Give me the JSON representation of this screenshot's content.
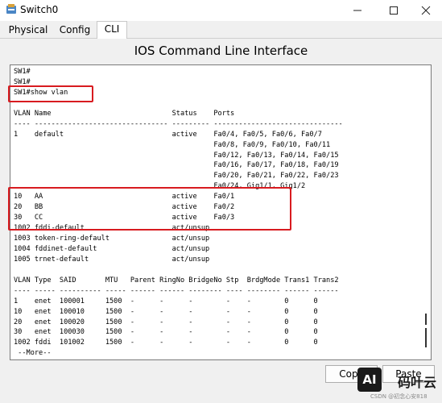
{
  "window": {
    "title": "Switch0",
    "minimize_icon": "minimize-icon",
    "maximize_icon": "maximize-icon",
    "close_icon": "close-icon"
  },
  "tabs": [
    {
      "label": "Physical",
      "active": false
    },
    {
      "label": "Config",
      "active": false
    },
    {
      "label": "CLI",
      "active": true
    }
  ],
  "cli_title": "IOS Command Line Interface",
  "terminal_lines": [
    "SW1#",
    "SW1#",
    "SW1#show vlan",
    "",
    "VLAN Name                             Status    Ports",
    "---- -------------------------------- --------- -------------------------------",
    "1    default                          active    Fa0/4, Fa0/5, Fa0/6, Fa0/7",
    "                                                Fa0/8, Fa0/9, Fa0/10, Fa0/11",
    "                                                Fa0/12, Fa0/13, Fa0/14, Fa0/15",
    "                                                Fa0/16, Fa0/17, Fa0/18, Fa0/19",
    "                                                Fa0/20, Fa0/21, Fa0/22, Fa0/23",
    "                                                Fa0/24, Gig1/1, Gig1/2",
    "10   AA                               active    Fa0/1",
    "20   BB                               active    Fa0/2",
    "30   CC                               active    Fa0/3",
    "1002 fddi-default                     act/unsup",
    "1003 token-ring-default               act/unsup",
    "1004 fddinet-default                  act/unsup",
    "1005 trnet-default                    act/unsup",
    "",
    "VLAN Type  SAID       MTU   Parent RingNo BridgeNo Stp  BrdgMode Trans1 Trans2",
    "---- ----- ---------- ----- ------ ------ -------- ---- -------- ------ ------",
    "1    enet  100001     1500  -      -      -        -    -        0      0",
    "10   enet  100010     1500  -      -      -        -    -        0      0",
    "20   enet  100020     1500  -      -      -        -    -        0      0",
    "30   enet  100030     1500  -      -      -        -    -        0      0",
    "1002 fddi  101002     1500  -      -      -        -    -        0      0",
    " --More--"
  ],
  "buttons": {
    "copy": "Copy",
    "paste": "Paste"
  },
  "watermark": {
    "logo": "AI",
    "brand": "码叶云",
    "credit": "CSDN @初念心安818"
  },
  "colors": {
    "highlight": "#d81b20"
  }
}
